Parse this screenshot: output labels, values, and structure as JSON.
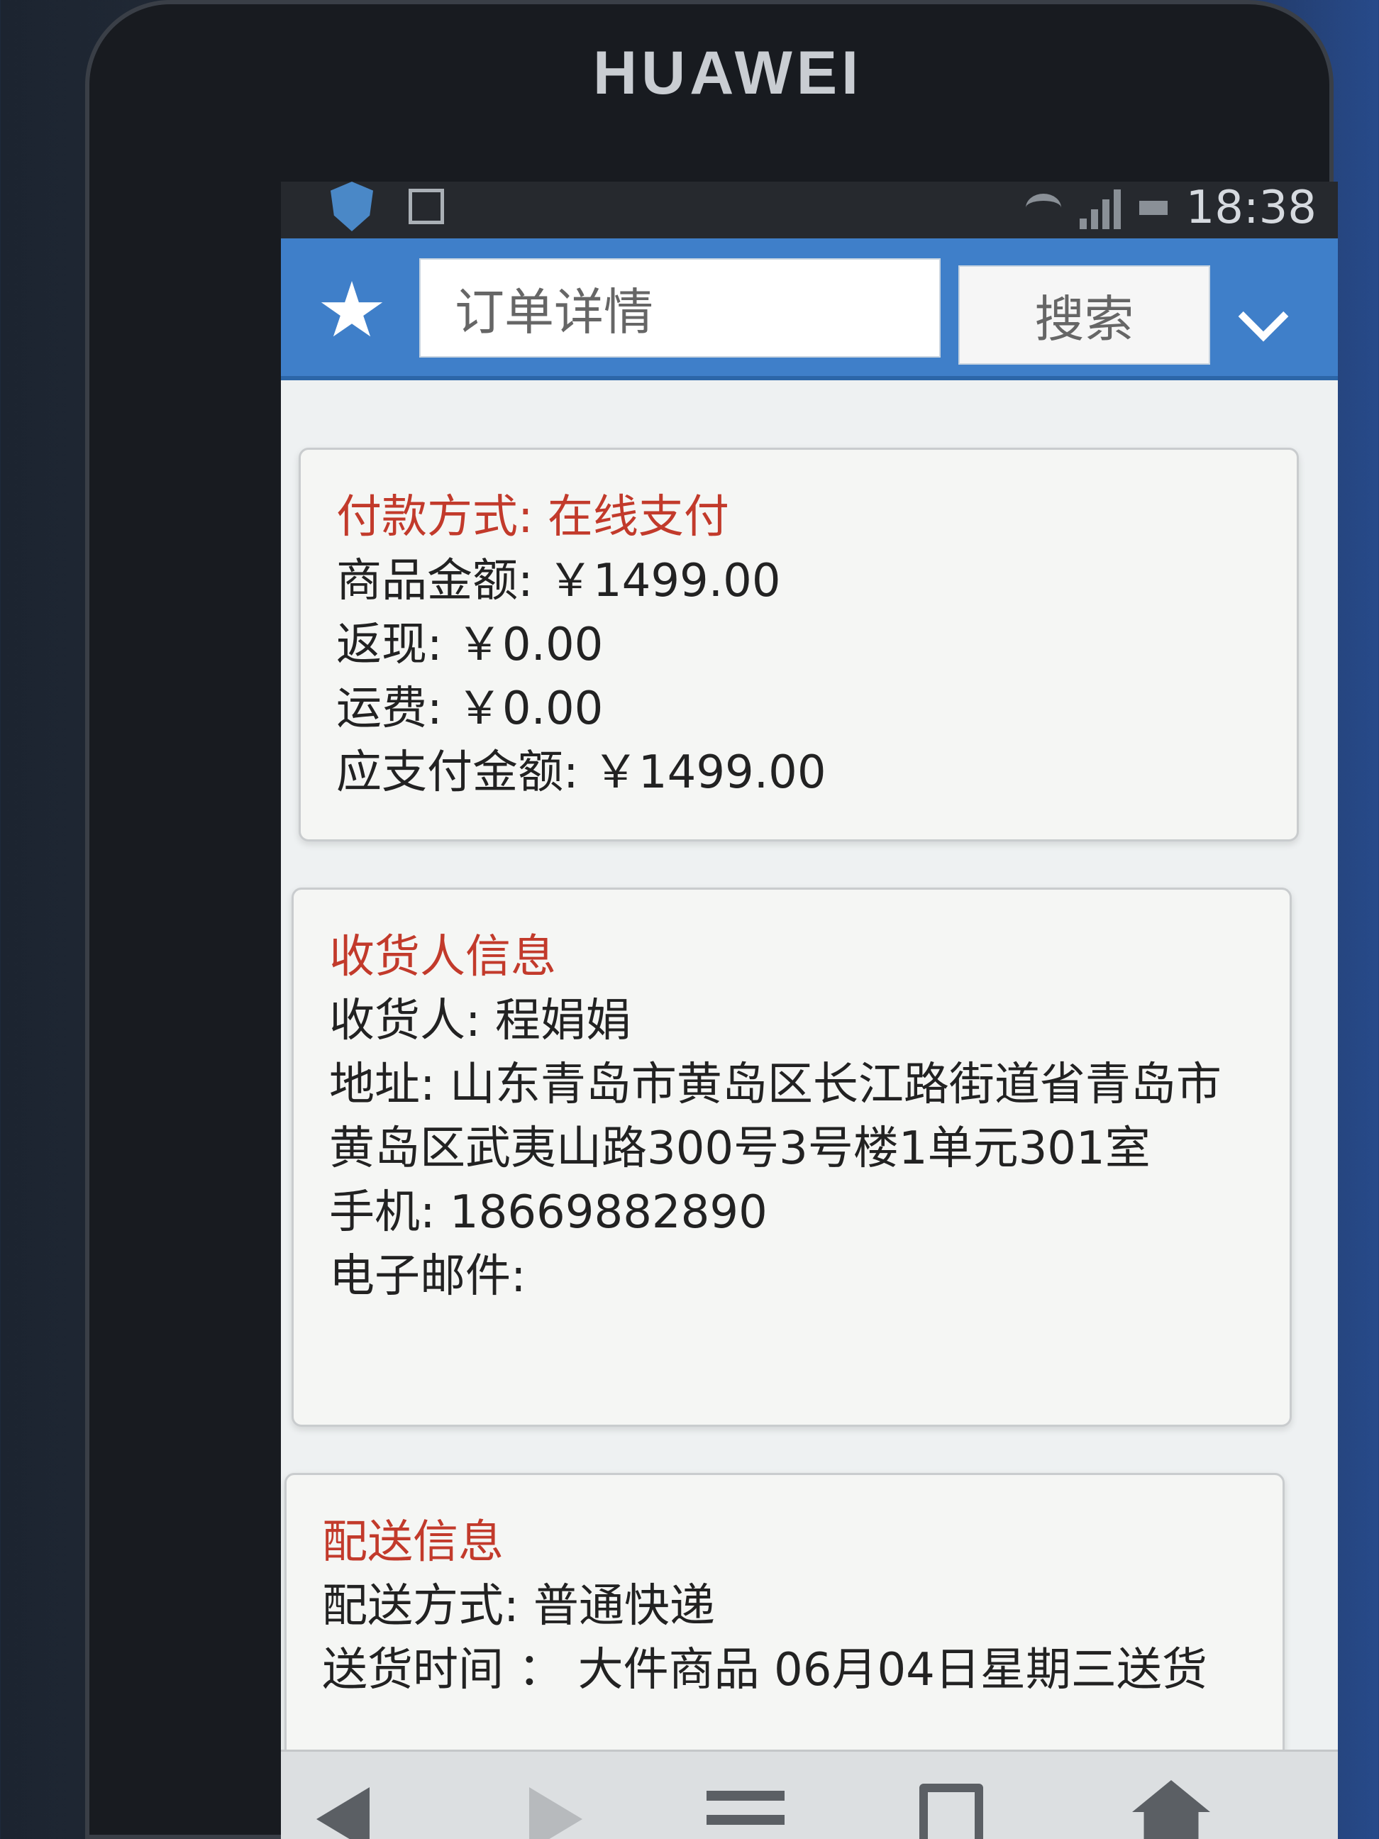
{
  "device": {
    "brand": "HUAWEI"
  },
  "status_bar": {
    "time": "18:38"
  },
  "app_bar": {
    "title": "订单详情",
    "search_label": "搜索"
  },
  "payment": {
    "title": "付款方式: 在线支付",
    "rows": [
      "商品金额: ￥1499.00",
      "返现: ￥0.00",
      "运费: ￥0.00",
      "应支付金额: ￥1499.00"
    ]
  },
  "receiver": {
    "title": "收货人信息",
    "name": "收货人: 程娟娟",
    "address": "地址: 山东青岛市黄岛区长江路街道省青岛市黄岛区武夷山路300号3号楼1单元301室",
    "phone": "手机: 18669882890",
    "email": "电子邮件:"
  },
  "delivery": {
    "title": "配送信息",
    "method": "配送方式: 普通快递",
    "time": "送货时间 ： 大件商品 06月04日星期三送货"
  },
  "colors": {
    "accent": "#3f7fc9",
    "section_title": "#c23a2b"
  }
}
